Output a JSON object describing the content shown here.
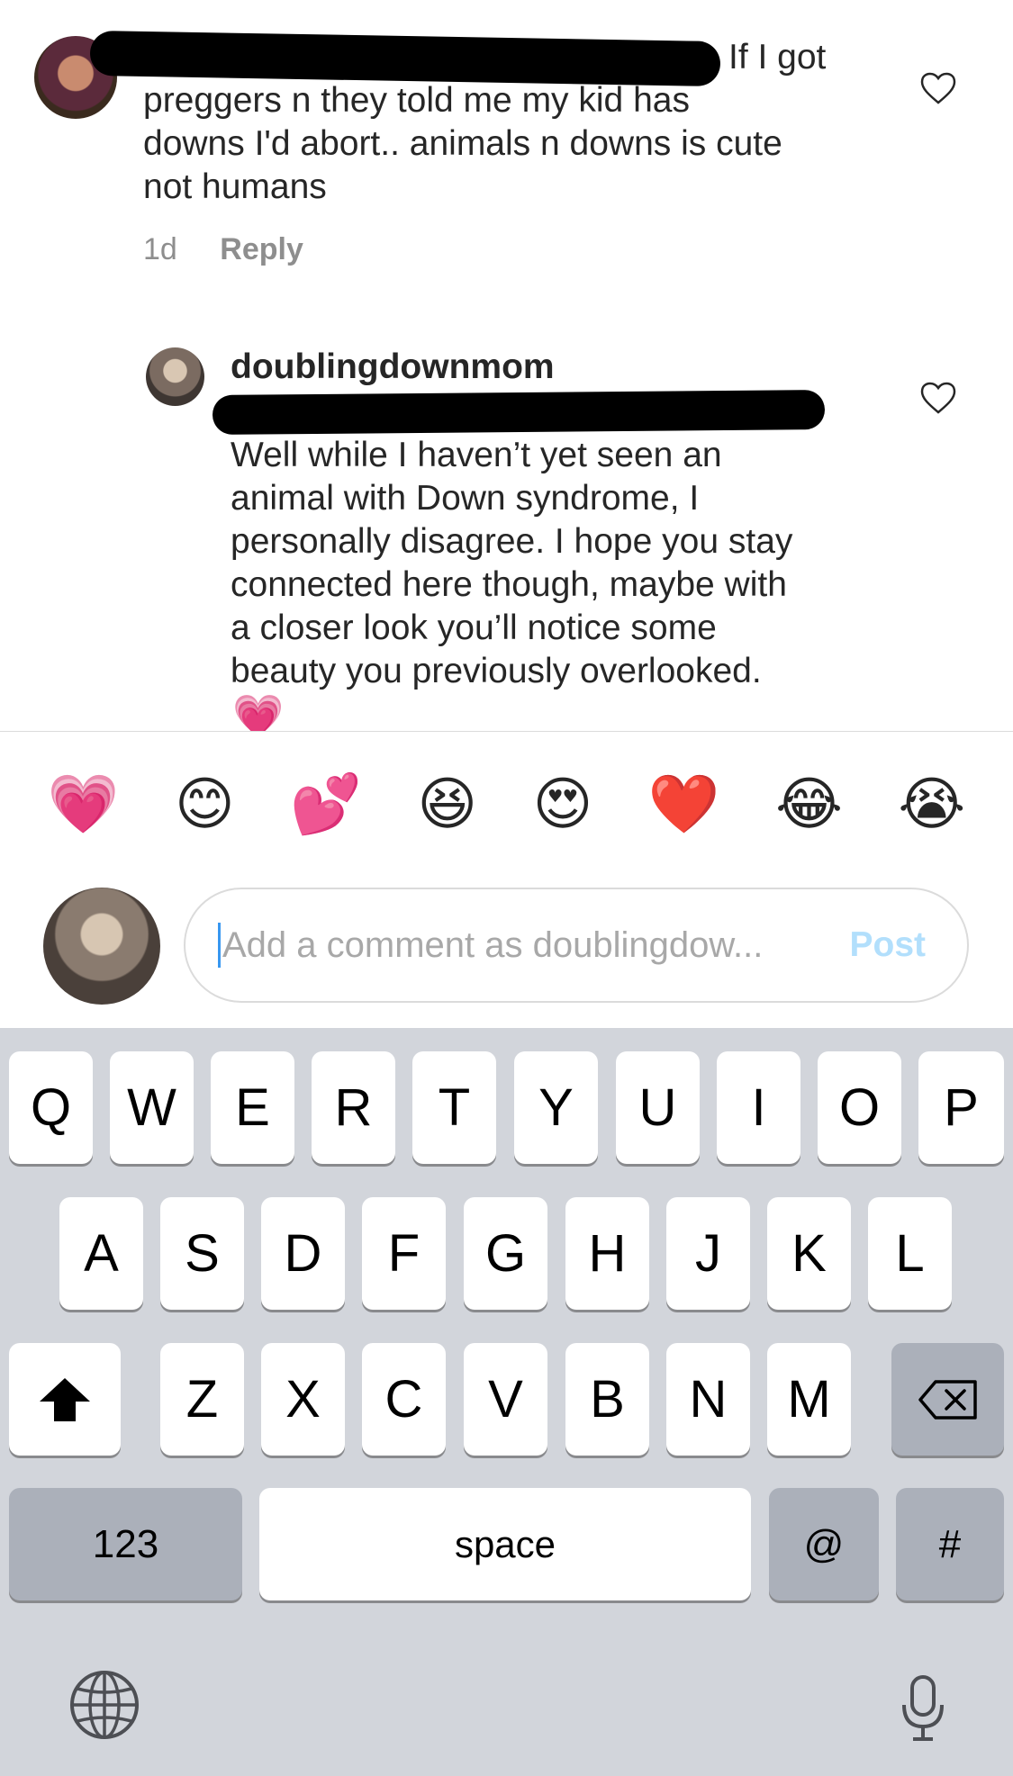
{
  "comments": [
    {
      "text": "If I got preggers n they told me my kid has downs I'd abort.. animals n downs is cute not humans",
      "line1": "If I got",
      "line2": "preggers n they told me my kid has",
      "line3": "downs I'd abort.. animals n downs is cute",
      "line4": "not humans",
      "time": "1d",
      "reply_label": "Reply"
    },
    {
      "username": "doublingdownmom",
      "line1": "Well while I haven’t yet seen an",
      "line2": "animal with Down syndrome, I",
      "line3": "personally disagree. I hope you stay",
      "line4": "connected here though, maybe with",
      "line5": "a closer look you’ll notice some",
      "line6": "beauty you previously overlooked.",
      "emoji": "💗"
    }
  ],
  "emoji_bar": [
    "💗",
    "😊",
    "💕",
    "😆",
    "😍",
    "❤️",
    "😂",
    "😭"
  ],
  "comment_input": {
    "placeholder": "Add a comment as doublingdow...",
    "post_label": "Post"
  },
  "keyboard": {
    "row1": [
      "Q",
      "W",
      "E",
      "R",
      "T",
      "Y",
      "U",
      "I",
      "O",
      "P"
    ],
    "row2": [
      "A",
      "S",
      "D",
      "F",
      "G",
      "H",
      "J",
      "K",
      "L"
    ],
    "row3": [
      "Z",
      "X",
      "C",
      "V",
      "B",
      "N",
      "M"
    ],
    "numbers_label": "123",
    "space_label": "space",
    "at_label": "@",
    "hash_label": "#"
  },
  "colors": {
    "accent_blue": "#3897f0",
    "post_disabled": "#b2dffc",
    "keyboard_bg": "#d2d5db"
  }
}
